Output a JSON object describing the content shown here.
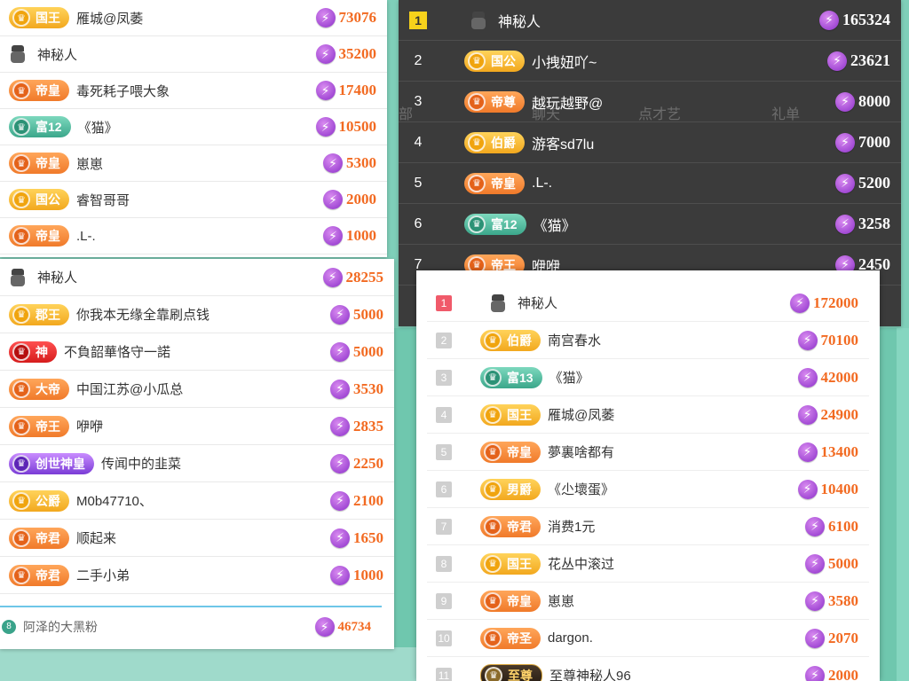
{
  "panel_a": {
    "rows": [
      {
        "badge": "国王",
        "badge_style": "gold",
        "name": "雁城@凤萎",
        "score": "73076"
      },
      {
        "badge": "",
        "badge_style": "mystery",
        "name": "神秘人",
        "score": "35200"
      },
      {
        "badge": "帝皇",
        "badge_style": "orange",
        "name": "毒死耗子喂大象",
        "score": "17400"
      },
      {
        "badge": "富12",
        "badge_style": "green",
        "name": "《猫》",
        "score": "10500"
      },
      {
        "badge": "帝皇",
        "badge_style": "orange",
        "name": "崽崽",
        "score": "5300"
      },
      {
        "badge": "国公",
        "badge_style": "gold",
        "name": "睿智哥哥",
        "score": "2000"
      },
      {
        "badge": "帝皇",
        "badge_style": "orange",
        "name": ".L-.",
        "score": "1000"
      }
    ]
  },
  "panel_b": {
    "rows": [
      {
        "badge": "",
        "badge_style": "mystery",
        "name": "神秘人",
        "score": "28255"
      },
      {
        "badge": "郡王",
        "badge_style": "gold",
        "name": "你我本无缘全靠刷点钱",
        "score": "5000"
      },
      {
        "badge": "神",
        "badge_style": "red",
        "name": "不負韶華恪守一諾",
        "score": "5000"
      },
      {
        "badge": "大帝",
        "badge_style": "orange",
        "name": "中国江苏@小瓜总",
        "score": "3530"
      },
      {
        "badge": "帝王",
        "badge_style": "orange",
        "name": "咿咿",
        "score": "2835"
      },
      {
        "badge": "创世神皇",
        "badge_style": "purple",
        "name": "传闻中的韭菜",
        "score": "2250"
      },
      {
        "badge": "公爵",
        "badge_style": "gold",
        "name": "M0b47710、",
        "score": "2100"
      },
      {
        "badge": "帝君",
        "badge_style": "orange",
        "name": "顺起来",
        "score": "1650"
      },
      {
        "badge": "帝君",
        "badge_style": "orange",
        "name": "二手小弟",
        "score": "1000"
      }
    ],
    "footer": {
      "rank": "8",
      "name": "阿泽的大黑粉",
      "score": "46734"
    }
  },
  "panel_c": {
    "ghost_tabs": [
      "部",
      "聊天",
      "点才艺",
      "礼单"
    ],
    "rows": [
      {
        "rank": "1",
        "badge": "",
        "badge_style": "mystery",
        "name": "神秘人",
        "score": "165324"
      },
      {
        "rank": "2",
        "badge": "国公",
        "badge_style": "gold",
        "name": "小拽妞吖~",
        "score": "23621"
      },
      {
        "rank": "3",
        "badge": "帝尊",
        "badge_style": "orange",
        "name": "越玩越野@",
        "score": "8000"
      },
      {
        "rank": "4",
        "badge": "伯爵",
        "badge_style": "gold",
        "name": "游客sd7lu",
        "score": "7000"
      },
      {
        "rank": "5",
        "badge": "帝皇",
        "badge_style": "orange",
        "name": ".L-.",
        "score": "5200"
      },
      {
        "rank": "6",
        "badge": "富12",
        "badge_style": "green",
        "name": "《猫》",
        "score": "3258"
      },
      {
        "rank": "7",
        "badge": "帝王",
        "badge_style": "orange",
        "name": "咿咿",
        "score": "2450"
      }
    ]
  },
  "panel_d": {
    "rows": [
      {
        "rank": "1",
        "badge": "",
        "badge_style": "mystery",
        "name": "神秘人",
        "score": "172000"
      },
      {
        "rank": "2",
        "badge": "伯爵",
        "badge_style": "gold",
        "name": "南宫春水",
        "score": "70100"
      },
      {
        "rank": "3",
        "badge": "富13",
        "badge_style": "green",
        "name": "《猫》",
        "score": "42000"
      },
      {
        "rank": "4",
        "badge": "国王",
        "badge_style": "gold",
        "name": "雁城@凤萎",
        "score": "24900"
      },
      {
        "rank": "5",
        "badge": "帝皇",
        "badge_style": "orange",
        "name": "夢裏啥都有",
        "score": "13400"
      },
      {
        "rank": "6",
        "badge": "男爵",
        "badge_style": "gold",
        "name": "《尐壞蛋》",
        "score": "10400"
      },
      {
        "rank": "7",
        "badge": "帝君",
        "badge_style": "orange",
        "name": "消费1元",
        "score": "6100"
      },
      {
        "rank": "8",
        "badge": "国王",
        "badge_style": "gold",
        "name": "花丛中滚过",
        "score": "5000"
      },
      {
        "rank": "9",
        "badge": "帝皇",
        "badge_style": "orange",
        "name": "崽崽",
        "score": "3580"
      },
      {
        "rank": "10",
        "badge": "帝圣",
        "badge_style": "orange",
        "name": "dargon.",
        "score": "2070"
      },
      {
        "rank": "11",
        "badge": "至尊",
        "badge_style": "dark",
        "name": "至尊神秘人96",
        "score": "2000"
      }
    ]
  },
  "icons": {
    "score": "lightning-bolt-icon",
    "mystery": "mystery-avatar-icon",
    "badge": "rank-emblem-icon"
  },
  "colors": {
    "score": "#f26a21",
    "bolt": "#8b2fc9",
    "rank_top": "#f05a6a",
    "rank_one_dark": "#f7d21b"
  }
}
